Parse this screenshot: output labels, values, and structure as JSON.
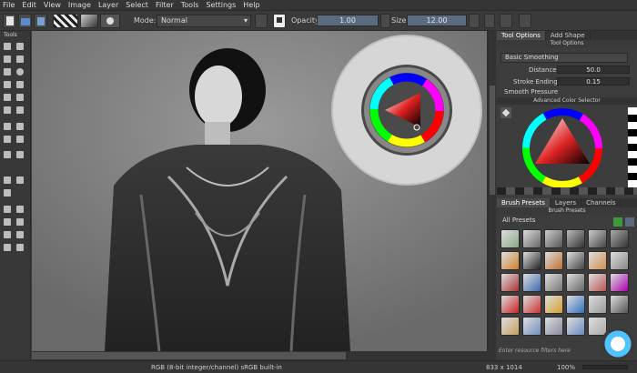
{
  "menu": [
    "File",
    "Edit",
    "View",
    "Image",
    "Layer",
    "Select",
    "Filter",
    "Tools",
    "Settings",
    "Help"
  ],
  "toolbar": {
    "mode_label": "Mode:",
    "blend_mode": "Normal",
    "opacity_label": "Opacity",
    "opacity_value": "1.00",
    "size_label": "Size",
    "size_value": "12.00"
  },
  "toolbox": {
    "title": "Tools"
  },
  "tool_options": {
    "tabs": [
      "Tool Options",
      "Add Shape"
    ],
    "subtitle": "Tool Options",
    "smoothing_mode": "Basic Smoothing",
    "distance_label": "Distance:",
    "distance_value": "50.0",
    "stroke_ending_label": "Stroke Ending:",
    "stroke_ending_value": "0.15",
    "smooth_pressure_label": "Smooth Pressure"
  },
  "color_selector": {
    "title": "Advanced Color Selector"
  },
  "brush_presets": {
    "tabs": [
      "Brush Presets",
      "Layers",
      "Channels"
    ],
    "subtitle": "Brush Presets",
    "filter_value": "All Presets",
    "search_placeholder": "Enter resource filters here"
  },
  "status": {
    "color_info": "RGB (8-bit integer/channel)  sRGB built-in",
    "dimensions": "833 x 1014",
    "zoom": "100%"
  },
  "colors": {
    "fg": "#ffffff",
    "bg": "#000000",
    "accent": "#5a6b80"
  }
}
